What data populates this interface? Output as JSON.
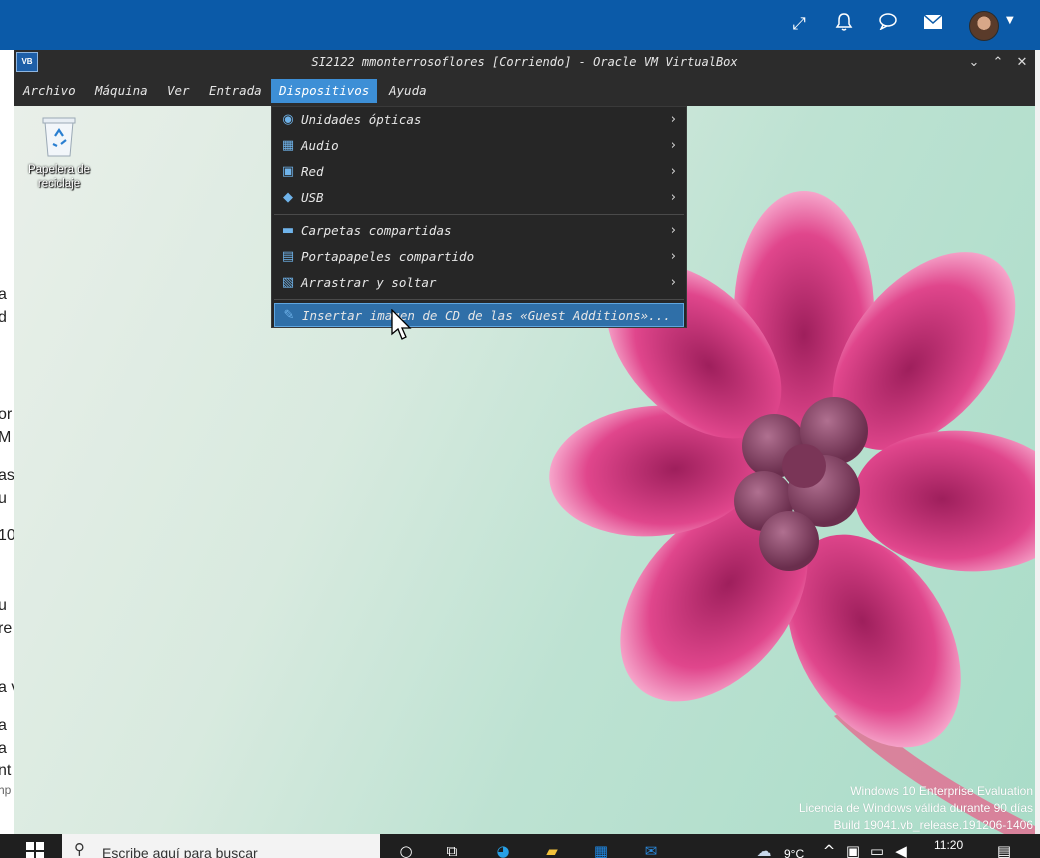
{
  "window": {
    "title": "SI2122 mmonterrosoflores [Corriendo] - Oracle VM VirtualBox"
  },
  "menubar": {
    "items": [
      "Archivo",
      "Máquina",
      "Ver",
      "Entrada",
      "Dispositivos",
      "Ayuda"
    ],
    "active": "Dispositivos"
  },
  "devices_menu": {
    "items": [
      {
        "label": "Unidades ópticas",
        "icon": "optical-disc-icon",
        "submenu": true
      },
      {
        "label": "Audio",
        "icon": "audio-icon",
        "submenu": true
      },
      {
        "label": "Red",
        "icon": "network-icon",
        "submenu": true
      },
      {
        "label": "USB",
        "icon": "usb-icon",
        "submenu": true
      },
      {
        "label": "Carpetas compartidas",
        "icon": "shared-folder-icon",
        "submenu": true
      },
      {
        "label": "Portapapeles compartido",
        "icon": "clipboard-icon",
        "submenu": true
      },
      {
        "label": "Arrastrar y soltar",
        "icon": "drag-drop-icon",
        "submenu": true
      },
      {
        "label": "Insertar imagen de CD de las «Guest Additions»...",
        "icon": "guest-additions-icon",
        "submenu": false,
        "highlighted": true
      }
    ]
  },
  "desktop": {
    "recycle_bin_label": "Papelera de reciclaje",
    "watermark": {
      "line1": "Windows 10 Enterprise Evaluation",
      "line2": "Licencia de Windows válida durante 90 días",
      "line3": "Build 19041.vb_release.191206-1406"
    }
  },
  "host_side_text": [
    "a",
    "d",
    "or",
    "M",
    "as",
    "u",
    "10",
    "u",
    "re",
    "a v",
    "a",
    "a",
    "nt",
    "hp"
  ],
  "taskbar": {
    "search_placeholder": "Escribe aquí para buscar",
    "temperature": "9°C",
    "time": "11:20"
  },
  "colors": {
    "host_header": "#0b5aa8",
    "menu_active": "#3d8fd6",
    "menu_highlight": "#2f6fa8",
    "vbox_chrome": "#2c2c2c"
  }
}
